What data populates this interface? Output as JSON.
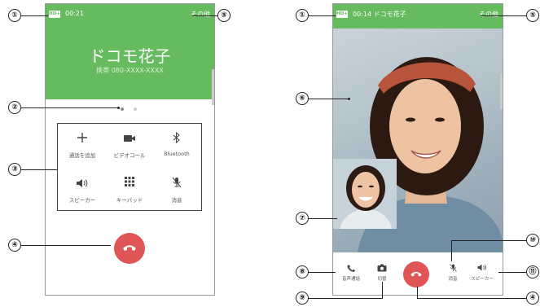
{
  "phone1": {
    "hd_badge": "HD+",
    "time": "00:21",
    "menu_label": "その他",
    "contact_name": "ドコモ花子",
    "phone_number": "携帯 080-XXXX-XXXX",
    "buttons": [
      {
        "label": "通話を追加",
        "icon": "plus-icon"
      },
      {
        "label": "ビデオコール",
        "icon": "video-call-icon"
      },
      {
        "label": "Bluetooth",
        "icon": "bluetooth-icon"
      },
      {
        "label": "スピーカー",
        "icon": "speaker-icon"
      },
      {
        "label": "キーパッド",
        "icon": "keypad-icon"
      },
      {
        "label": "消音",
        "icon": "mute-icon"
      }
    ]
  },
  "phone2": {
    "hd_badge": "HD+",
    "time_and_name": "00:14  ドコモ花子",
    "menu_label": "その他",
    "buttons": [
      {
        "label": "音声通話",
        "icon": "phone-icon"
      },
      {
        "label": "切替",
        "icon": "camera-switch-icon"
      },
      {
        "label": "消音",
        "icon": "mute-icon"
      },
      {
        "label": "スピーカー",
        "icon": "speaker-icon"
      }
    ]
  },
  "callouts": {
    "c1": "①",
    "c2": "②",
    "c3": "③",
    "c4": "④",
    "c5": "⑤",
    "c6": "⑥",
    "c7": "⑦",
    "c8": "⑧",
    "c9": "⑨",
    "c10": "⑩",
    "c11": "⑪"
  },
  "colors": {
    "green": "#66bb5e",
    "end_call": "#e05555",
    "page_dot_active": "#8c8c8c",
    "page_dot_inactive": "#cfcfcf"
  }
}
